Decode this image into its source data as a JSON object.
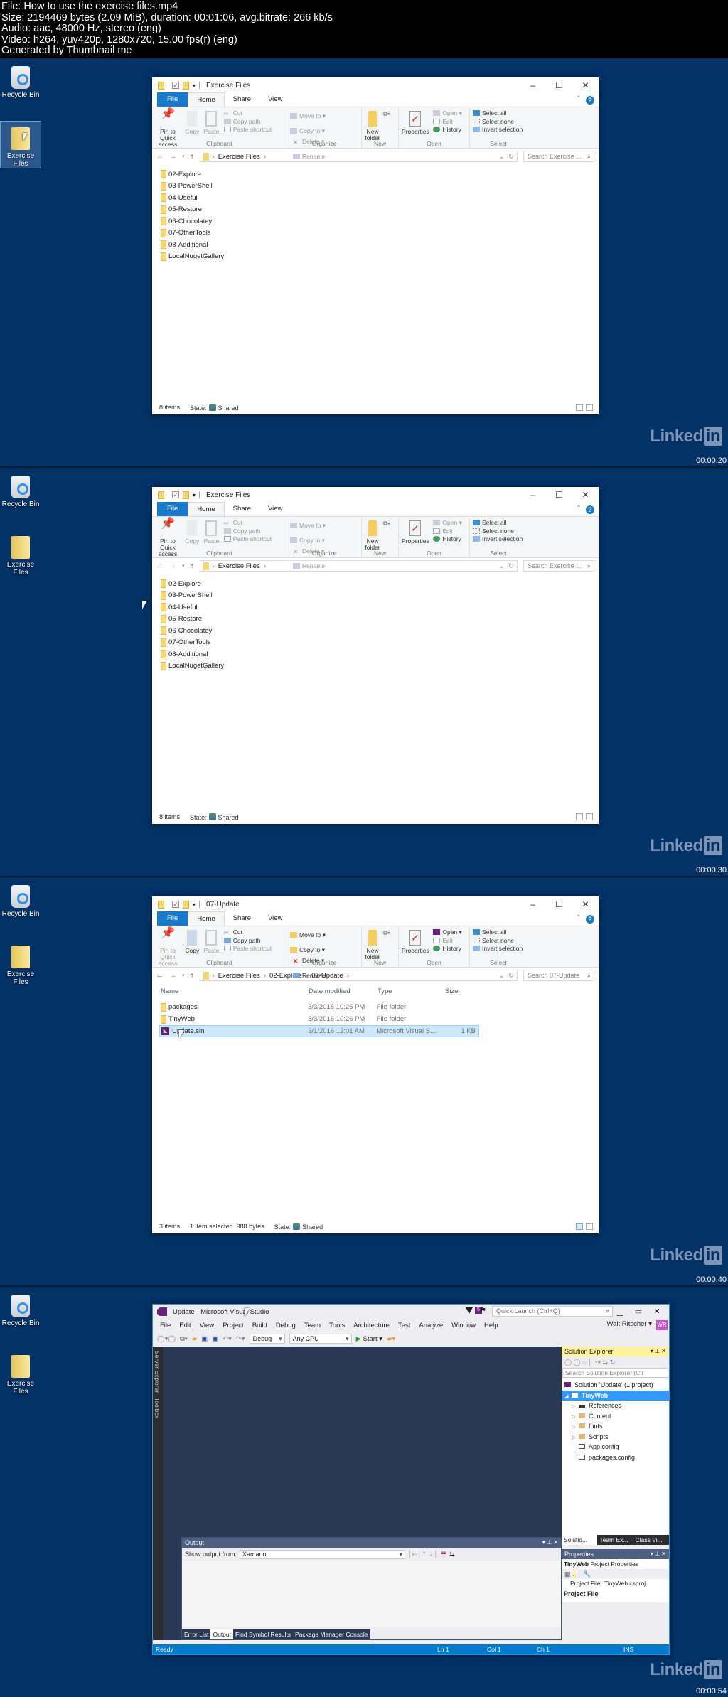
{
  "header": {
    "lines": [
      "File: How to use the exercise files.mp4",
      "Size: 2194469 bytes (2.09 MiB), duration: 00:01:06, avg.bitrate: 266 kb/s",
      "Audio: aac, 48000 Hz, stereo (eng)",
      "Video: h264, yuv420p, 1280x720, 15.00 fps(r) (eng)",
      "Generated by Thumbnail me"
    ]
  },
  "desktop": {
    "recycle_bin_label": "Recycle Bin",
    "exercise_files_label": "Exercise Files"
  },
  "watermark": {
    "brand": "Linked",
    "brand_box": "in"
  },
  "frames": [
    {
      "timestamp": "00:00:20"
    },
    {
      "timestamp": "00:00:30"
    },
    {
      "timestamp": "00:00:40"
    },
    {
      "timestamp": "00:00:54"
    }
  ],
  "ribbon": {
    "tabs": [
      "File",
      "Home",
      "Share",
      "View"
    ],
    "clipboard": {
      "pin": "Pin to Quick access",
      "copy": "Copy",
      "paste": "Paste",
      "cut": "Cut",
      "copy_path": "Copy path",
      "paste_shortcut": "Paste shortcut",
      "label": "Clipboard"
    },
    "organize": {
      "move_to": "Move to",
      "copy_to": "Copy to",
      "delete": "Delete",
      "rename": "Rename",
      "label": "Organize"
    },
    "new": {
      "new_folder": "New folder",
      "label": "New"
    },
    "open": {
      "properties": "Properties",
      "open": "Open",
      "edit": "Edit",
      "history": "History",
      "label": "Open"
    },
    "select": {
      "select_all": "Select all",
      "select_none": "Select none",
      "invert": "Invert selection",
      "label": "Select"
    }
  },
  "explorer1": {
    "title": "Exercise Files",
    "path": [
      "Exercise Files"
    ],
    "search_placeholder": "Search Exercise ...",
    "folders": [
      "02-Explore",
      "03-PowerShell",
      "04-Useful",
      "05-Restore",
      "06-Chocolatey",
      "07-OtherTools",
      "08-Additional",
      "LocalNugetGallery"
    ],
    "status_items": "8 items",
    "status_state_label": "State:",
    "status_state": "Shared"
  },
  "explorer3": {
    "title": "07-Update",
    "path": [
      "Exercise Files",
      "02-Explore",
      "07-Update"
    ],
    "search_placeholder": "Search 07-Update",
    "columns": [
      "Name",
      "Date modified",
      "Type",
      "Size"
    ],
    "rows": [
      {
        "name": "packages",
        "date": "3/3/2016 10:26 PM",
        "type": "File folder",
        "size": "",
        "icon": "folder-icon"
      },
      {
        "name": "TinyWeb",
        "date": "3/3/2016 10:26 PM",
        "type": "File folder",
        "size": "",
        "icon": "folder-icon"
      },
      {
        "name": "Update.sln",
        "date": "3/1/2016 12:01 AM",
        "type": "Microsoft Visual S...",
        "size": "1 KB",
        "icon": "vs-solution-icon",
        "selected": true
      }
    ],
    "status_items": "3 items",
    "status_selected": "1 item selected",
    "status_size": "988 bytes",
    "status_state_label": "State:",
    "status_state": "Shared"
  },
  "vs": {
    "title": "Update - Microsoft Visual Studio",
    "notification_count": "5",
    "quick_launch_placeholder": "Quick Launch (Ctrl+Q)",
    "menu": [
      "File",
      "Edit",
      "View",
      "Project",
      "Build",
      "Debug",
      "Team",
      "Tools",
      "Architecture",
      "Test",
      "Analyze",
      "Window",
      "Help"
    ],
    "user": "Walt Ritscher",
    "user_initials": "WR",
    "config": "Debug",
    "platform": "Any CPU",
    "start": "Start",
    "side_tabs": [
      "Server Explorer",
      "Toolbox"
    ],
    "output": {
      "title": "Output",
      "show_from_label": "Show output from:",
      "show_from_value": "Xamarin",
      "tabs": [
        "Error List",
        "Output",
        "Find Symbol Results",
        "Package Manager Console"
      ]
    },
    "solution_explorer": {
      "title": "Solution Explorer",
      "search_placeholder": "Search Solution Explorer (Ctr",
      "tree": [
        {
          "label": "Solution 'Update' (1 project)",
          "level": 0,
          "icon": "solution-icon"
        },
        {
          "label": "TinyWeb",
          "level": 0,
          "icon": "csharp-project-icon",
          "expanded": true,
          "selected": true
        },
        {
          "label": "References",
          "level": 1,
          "icon": "references-icon",
          "collapsed": true
        },
        {
          "label": "Content",
          "level": 1,
          "icon": "folder-icon",
          "collapsed": true
        },
        {
          "label": "fonts",
          "level": 1,
          "icon": "folder-icon",
          "collapsed": true
        },
        {
          "label": "Scripts",
          "level": 1,
          "icon": "folder-icon",
          "collapsed": true
        },
        {
          "label": "App.config",
          "level": 1,
          "icon": "config-file-icon"
        },
        {
          "label": "packages.config",
          "level": 1,
          "icon": "config-file-icon"
        }
      ],
      "tabs": [
        "Solutio...",
        "Team Ex...",
        "Class Vi..."
      ]
    },
    "properties": {
      "title": "Properties",
      "object_name": "TinyWeb",
      "object_type": "Project Properties",
      "key": "Project File",
      "value": "TinyWeb.csproj",
      "description_title": "Project File"
    },
    "status": {
      "ready": "Ready",
      "ln": "Ln 1",
      "col": "Col 1",
      "ch": "Ch 1",
      "mode": "INS"
    }
  }
}
